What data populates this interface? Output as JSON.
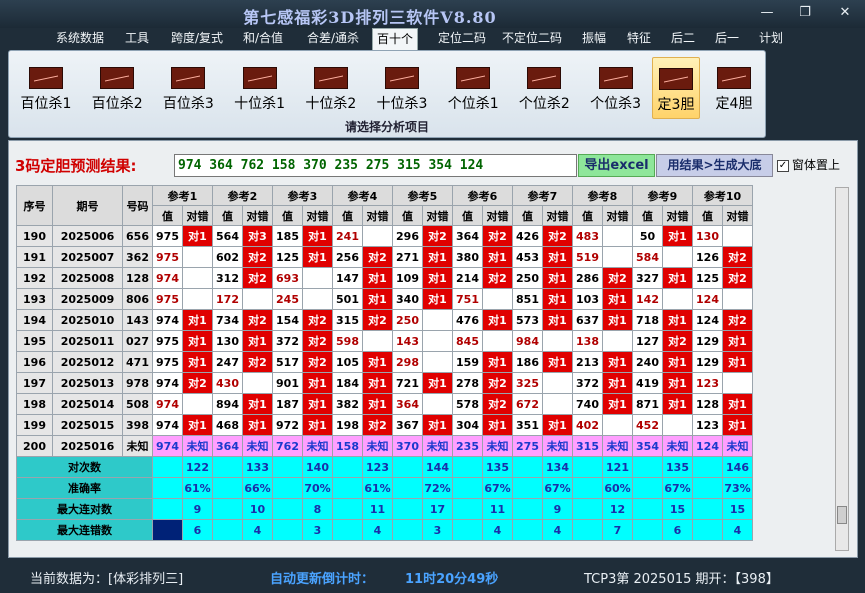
{
  "window": {
    "title": "第七感福彩3D排列三软件V8.80",
    "min": "—",
    "max": "❐",
    "close": "✕"
  },
  "menu": [
    "系统数据",
    "工具",
    "跨度/复式",
    "和/合值",
    "合差/通杀",
    "百十个",
    "定位二码",
    "不定位二码",
    "振幅",
    "特征",
    "后二",
    "后一",
    "计划"
  ],
  "menu_active": 5,
  "ribbon": {
    "buttons": [
      "百位杀1",
      "百位杀2",
      "百位杀3",
      "十位杀1",
      "十位杀2",
      "十位杀3",
      "个位杀1",
      "个位杀2",
      "个位杀3",
      "定3胆",
      "定4胆"
    ],
    "selected": 9,
    "caption": "请选择分析项目"
  },
  "result": {
    "label": "3码定胆预测结果:",
    "value": "974 364 762 158 370 235 275 315 354 124",
    "export": "导出excel",
    "generate": "用结果>生成大底",
    "ontop": "窗体置上",
    "check": "✓"
  },
  "headers": {
    "seq": "序号",
    "period": "期号",
    "num": "号码",
    "refs": [
      "参考1",
      "参考2",
      "参考3",
      "参考4",
      "参考5",
      "参考6",
      "参考7",
      "参考8",
      "参考9",
      "参考10"
    ],
    "val": "值",
    "flag": "对错"
  },
  "rows": [
    {
      "seq": "190",
      "period": "2025006",
      "num": "656",
      "cells": [
        [
          "975",
          "对1"
        ],
        [
          "564",
          "对3"
        ],
        [
          "185",
          "对1"
        ],
        [
          "241",
          ""
        ],
        [
          "296",
          "对2"
        ],
        [
          "364",
          "对2"
        ],
        [
          "426",
          "对2"
        ],
        [
          "483",
          ""
        ],
        [
          "50",
          "对1"
        ],
        [
          "130",
          ""
        ]
      ]
    },
    {
      "seq": "191",
      "period": "2025007",
      "num": "362",
      "cells": [
        [
          "975",
          ""
        ],
        [
          "602",
          "对2"
        ],
        [
          "125",
          "对1"
        ],
        [
          "256",
          "对2"
        ],
        [
          "271",
          "对1"
        ],
        [
          "380",
          "对1"
        ],
        [
          "453",
          "对1"
        ],
        [
          "519",
          ""
        ],
        [
          "584",
          ""
        ],
        [
          "126",
          "对2"
        ]
      ]
    },
    {
      "seq": "192",
      "period": "2025008",
      "num": "128",
      "cells": [
        [
          "974",
          ""
        ],
        [
          "312",
          "对2"
        ],
        [
          "693",
          ""
        ],
        [
          "147",
          "对1"
        ],
        [
          "109",
          "对1"
        ],
        [
          "214",
          "对2"
        ],
        [
          "250",
          "对1"
        ],
        [
          "286",
          "对2"
        ],
        [
          "327",
          "对1"
        ],
        [
          "125",
          "对2"
        ]
      ]
    },
    {
      "seq": "193",
      "period": "2025009",
      "num": "806",
      "cells": [
        [
          "975",
          ""
        ],
        [
          "172",
          ""
        ],
        [
          "245",
          ""
        ],
        [
          "501",
          "对1"
        ],
        [
          "340",
          "对1"
        ],
        [
          "751",
          ""
        ],
        [
          "851",
          "对1"
        ],
        [
          "103",
          "对1"
        ],
        [
          "142",
          ""
        ],
        [
          "124",
          ""
        ]
      ]
    },
    {
      "seq": "194",
      "period": "2025010",
      "num": "143",
      "cells": [
        [
          "974",
          "对1"
        ],
        [
          "734",
          "对2"
        ],
        [
          "154",
          "对2"
        ],
        [
          "315",
          "对2"
        ],
        [
          "250",
          ""
        ],
        [
          "476",
          "对1"
        ],
        [
          "573",
          "对1"
        ],
        [
          "637",
          "对1"
        ],
        [
          "718",
          "对1"
        ],
        [
          "124",
          "对2"
        ]
      ]
    },
    {
      "seq": "195",
      "period": "2025011",
      "num": "027",
      "cells": [
        [
          "975",
          "对1"
        ],
        [
          "130",
          "对1"
        ],
        [
          "372",
          "对2"
        ],
        [
          "598",
          ""
        ],
        [
          "143",
          ""
        ],
        [
          "845",
          ""
        ],
        [
          "984",
          ""
        ],
        [
          "138",
          ""
        ],
        [
          "127",
          "对2"
        ],
        [
          "129",
          "对1"
        ]
      ]
    },
    {
      "seq": "196",
      "period": "2025012",
      "num": "471",
      "cells": [
        [
          "975",
          "对1"
        ],
        [
          "247",
          "对2"
        ],
        [
          "517",
          "对2"
        ],
        [
          "105",
          "对1"
        ],
        [
          "298",
          ""
        ],
        [
          "159",
          "对1"
        ],
        [
          "186",
          "对1"
        ],
        [
          "213",
          "对1"
        ],
        [
          "240",
          "对1"
        ],
        [
          "129",
          "对1"
        ]
      ]
    },
    {
      "seq": "197",
      "period": "2025013",
      "num": "978",
      "cells": [
        [
          "974",
          "对2"
        ],
        [
          "430",
          ""
        ],
        [
          "901",
          "对1"
        ],
        [
          "184",
          "对1"
        ],
        [
          "721",
          "对1"
        ],
        [
          "278",
          "对2"
        ],
        [
          "325",
          ""
        ],
        [
          "372",
          "对1"
        ],
        [
          "419",
          "对1"
        ],
        [
          "123",
          ""
        ]
      ]
    },
    {
      "seq": "198",
      "period": "2025014",
      "num": "508",
      "cells": [
        [
          "974",
          ""
        ],
        [
          "894",
          "对1"
        ],
        [
          "187",
          "对1"
        ],
        [
          "382",
          "对1"
        ],
        [
          "364",
          ""
        ],
        [
          "578",
          "对2"
        ],
        [
          "672",
          ""
        ],
        [
          "740",
          "对1"
        ],
        [
          "871",
          "对1"
        ],
        [
          "128",
          "对1"
        ]
      ]
    },
    {
      "seq": "199",
      "period": "2025015",
      "num": "398",
      "cells": [
        [
          "974",
          "对1"
        ],
        [
          "468",
          "对1"
        ],
        [
          "972",
          "对1"
        ],
        [
          "198",
          "对2"
        ],
        [
          "367",
          "对1"
        ],
        [
          "304",
          "对1"
        ],
        [
          "351",
          "对1"
        ],
        [
          "402",
          ""
        ],
        [
          "452",
          ""
        ],
        [
          "123",
          "对1"
        ]
      ]
    }
  ],
  "pred": {
    "seq": "200",
    "period": "2025016",
    "num": "未知",
    "values": [
      "974",
      "364",
      "762",
      "158",
      "370",
      "235",
      "275",
      "315",
      "354",
      "124"
    ],
    "unknown": "未知"
  },
  "stats": [
    {
      "label": "对次数",
      "values": [
        "122",
        "133",
        "140",
        "123",
        "144",
        "135",
        "134",
        "121",
        "135",
        "146"
      ]
    },
    {
      "label": "准确率",
      "values": [
        "61%",
        "66%",
        "70%",
        "61%",
        "72%",
        "67%",
        "67%",
        "60%",
        "67%",
        "73%"
      ]
    },
    {
      "label": "最大连对数",
      "values": [
        "9",
        "10",
        "8",
        "11",
        "17",
        "11",
        "9",
        "12",
        "15",
        "15"
      ]
    },
    {
      "label": "最大连错数",
      "values": [
        "6",
        "4",
        "3",
        "4",
        "3",
        "4",
        "4",
        "7",
        "6",
        "4"
      ]
    }
  ],
  "status": {
    "current": "当前数据为：[体彩排列三]",
    "countdown_label": "自动更新倒计时：",
    "countdown": "11时20分49秒",
    "draw": "TCP3第 2025015 期开：【398】"
  }
}
